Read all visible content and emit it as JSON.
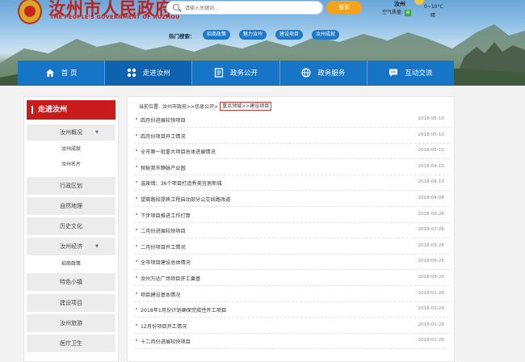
{
  "header": {
    "title": "汝州市人民政府",
    "subtitle": "THE PEOPLE'S GOVERNMENT OF RUZHOU",
    "search_placeholder": "请输入关键词...",
    "search_button": "搜索",
    "weather": {
      "city": "汝州",
      "air_label": "空气质量:",
      "air_level": "良",
      "temp": "0~10°C",
      "condition": "晴"
    },
    "hot_label": "热门搜索：",
    "hot_tags": [
      "招商政策",
      "魅力汝州",
      "建设项目",
      "汝州成就"
    ]
  },
  "nav": {
    "items": [
      {
        "label": "首 页",
        "icon": "home-icon"
      },
      {
        "label": "走进汝州",
        "icon": "grid-icon"
      },
      {
        "label": "政务公开",
        "icon": "document-icon"
      },
      {
        "label": "政务服务",
        "icon": "globe-icon"
      },
      {
        "label": "互动交流",
        "icon": "chat-icon"
      }
    ]
  },
  "sidebar": {
    "title": "走进汝州",
    "items": [
      {
        "label": "汝州概况",
        "has_sub": true
      },
      {
        "label": "汝州成就",
        "sub": true
      },
      {
        "label": "汝州名片",
        "sub": true
      },
      {
        "label": "行政区划"
      },
      {
        "label": "自然地理"
      },
      {
        "label": "历史文化"
      },
      {
        "label": "汝州经济",
        "has_sub": true
      },
      {
        "label": "招商政策",
        "sub": true
      },
      {
        "label": "特色小镇"
      },
      {
        "label": "建设项目"
      },
      {
        "label": "汝州旅游"
      },
      {
        "label": "医疗卫生"
      }
    ]
  },
  "breadcrumb": {
    "prefix": "当前位置:",
    "path": "汝州市政府>>信息公开>",
    "highlight_a": "重点领域",
    "sep": ">>",
    "highlight_b": "建设项目"
  },
  "news": [
    {
      "title": "四月份进展较快项目",
      "date": "2018-05-10"
    },
    {
      "title": "四月份项目开工情况",
      "date": "2018-05-10"
    },
    {
      "title": "全市第一批重大项目总体进展情况",
      "date": "2018-05-10"
    },
    {
      "title": "探秘我市静脉产业园",
      "date": "2018-04-13"
    },
    {
      "title": "温泉镇：36个项目打造秀美宜居新城",
      "date": "2018-04-13"
    },
    {
      "title": "望嵩路段提质工程启动部分公交线路改道",
      "date": "2018-04-08"
    },
    {
      "title": "下步项目推进工作打算",
      "date": "2018-03-26"
    },
    {
      "title": "二月份进展较快项目",
      "date": "2018-03-26"
    },
    {
      "title": "二月份项目开工情况",
      "date": "2018-03-26"
    },
    {
      "title": "全市项目建设总体情况",
      "date": "2018-03-26"
    },
    {
      "title": "汝州万达广场项目开工奠基",
      "date": "2018-03-20"
    },
    {
      "title": "项目建设基本情况",
      "date": "2018-01-29"
    },
    {
      "title": "2018年1月份计划确保完成性开工项目",
      "date": "2018-01-29"
    },
    {
      "title": "12月份项目开工情况",
      "date": "2018-01-29"
    },
    {
      "title": "十二月份进展较快项目",
      "date": "2018-01-29"
    }
  ]
}
